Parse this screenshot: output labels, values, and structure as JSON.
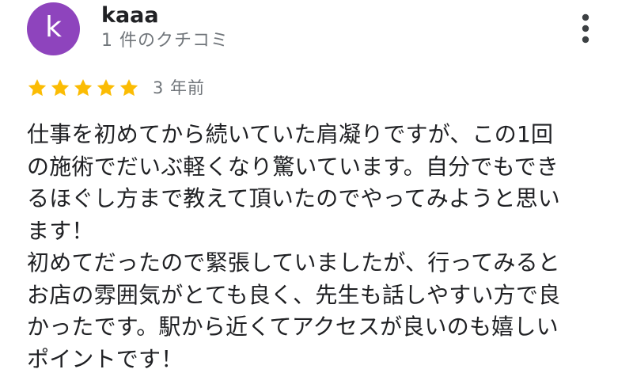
{
  "review": {
    "author": {
      "initial": "k",
      "name": "kaaa",
      "review_count": "1 件のクチコミ",
      "avatar_color": "#8e44bd"
    },
    "rating": {
      "stars": 5,
      "max": 5,
      "star_color": "#fbbc04"
    },
    "date": "3 年前",
    "body_lines": [
      "仕事を初めてから続いていた肩凝りですが、この1回",
      "の施術でだいぶ軽くなり驚いています。自分でもでき",
      "るほぐし方まで教えて頂いたのでやってみようと思い",
      "ます！",
      "初めてだったので緊張していましたが、行ってみると",
      "お店の雰囲気がとても良く、先生も話しやすい方で良",
      "かったです。駅から近くてアクセスが良いのも嬉しい",
      "ポイントです！"
    ]
  },
  "icons": {
    "more": "more-vert-icon",
    "star": "star-icon"
  }
}
